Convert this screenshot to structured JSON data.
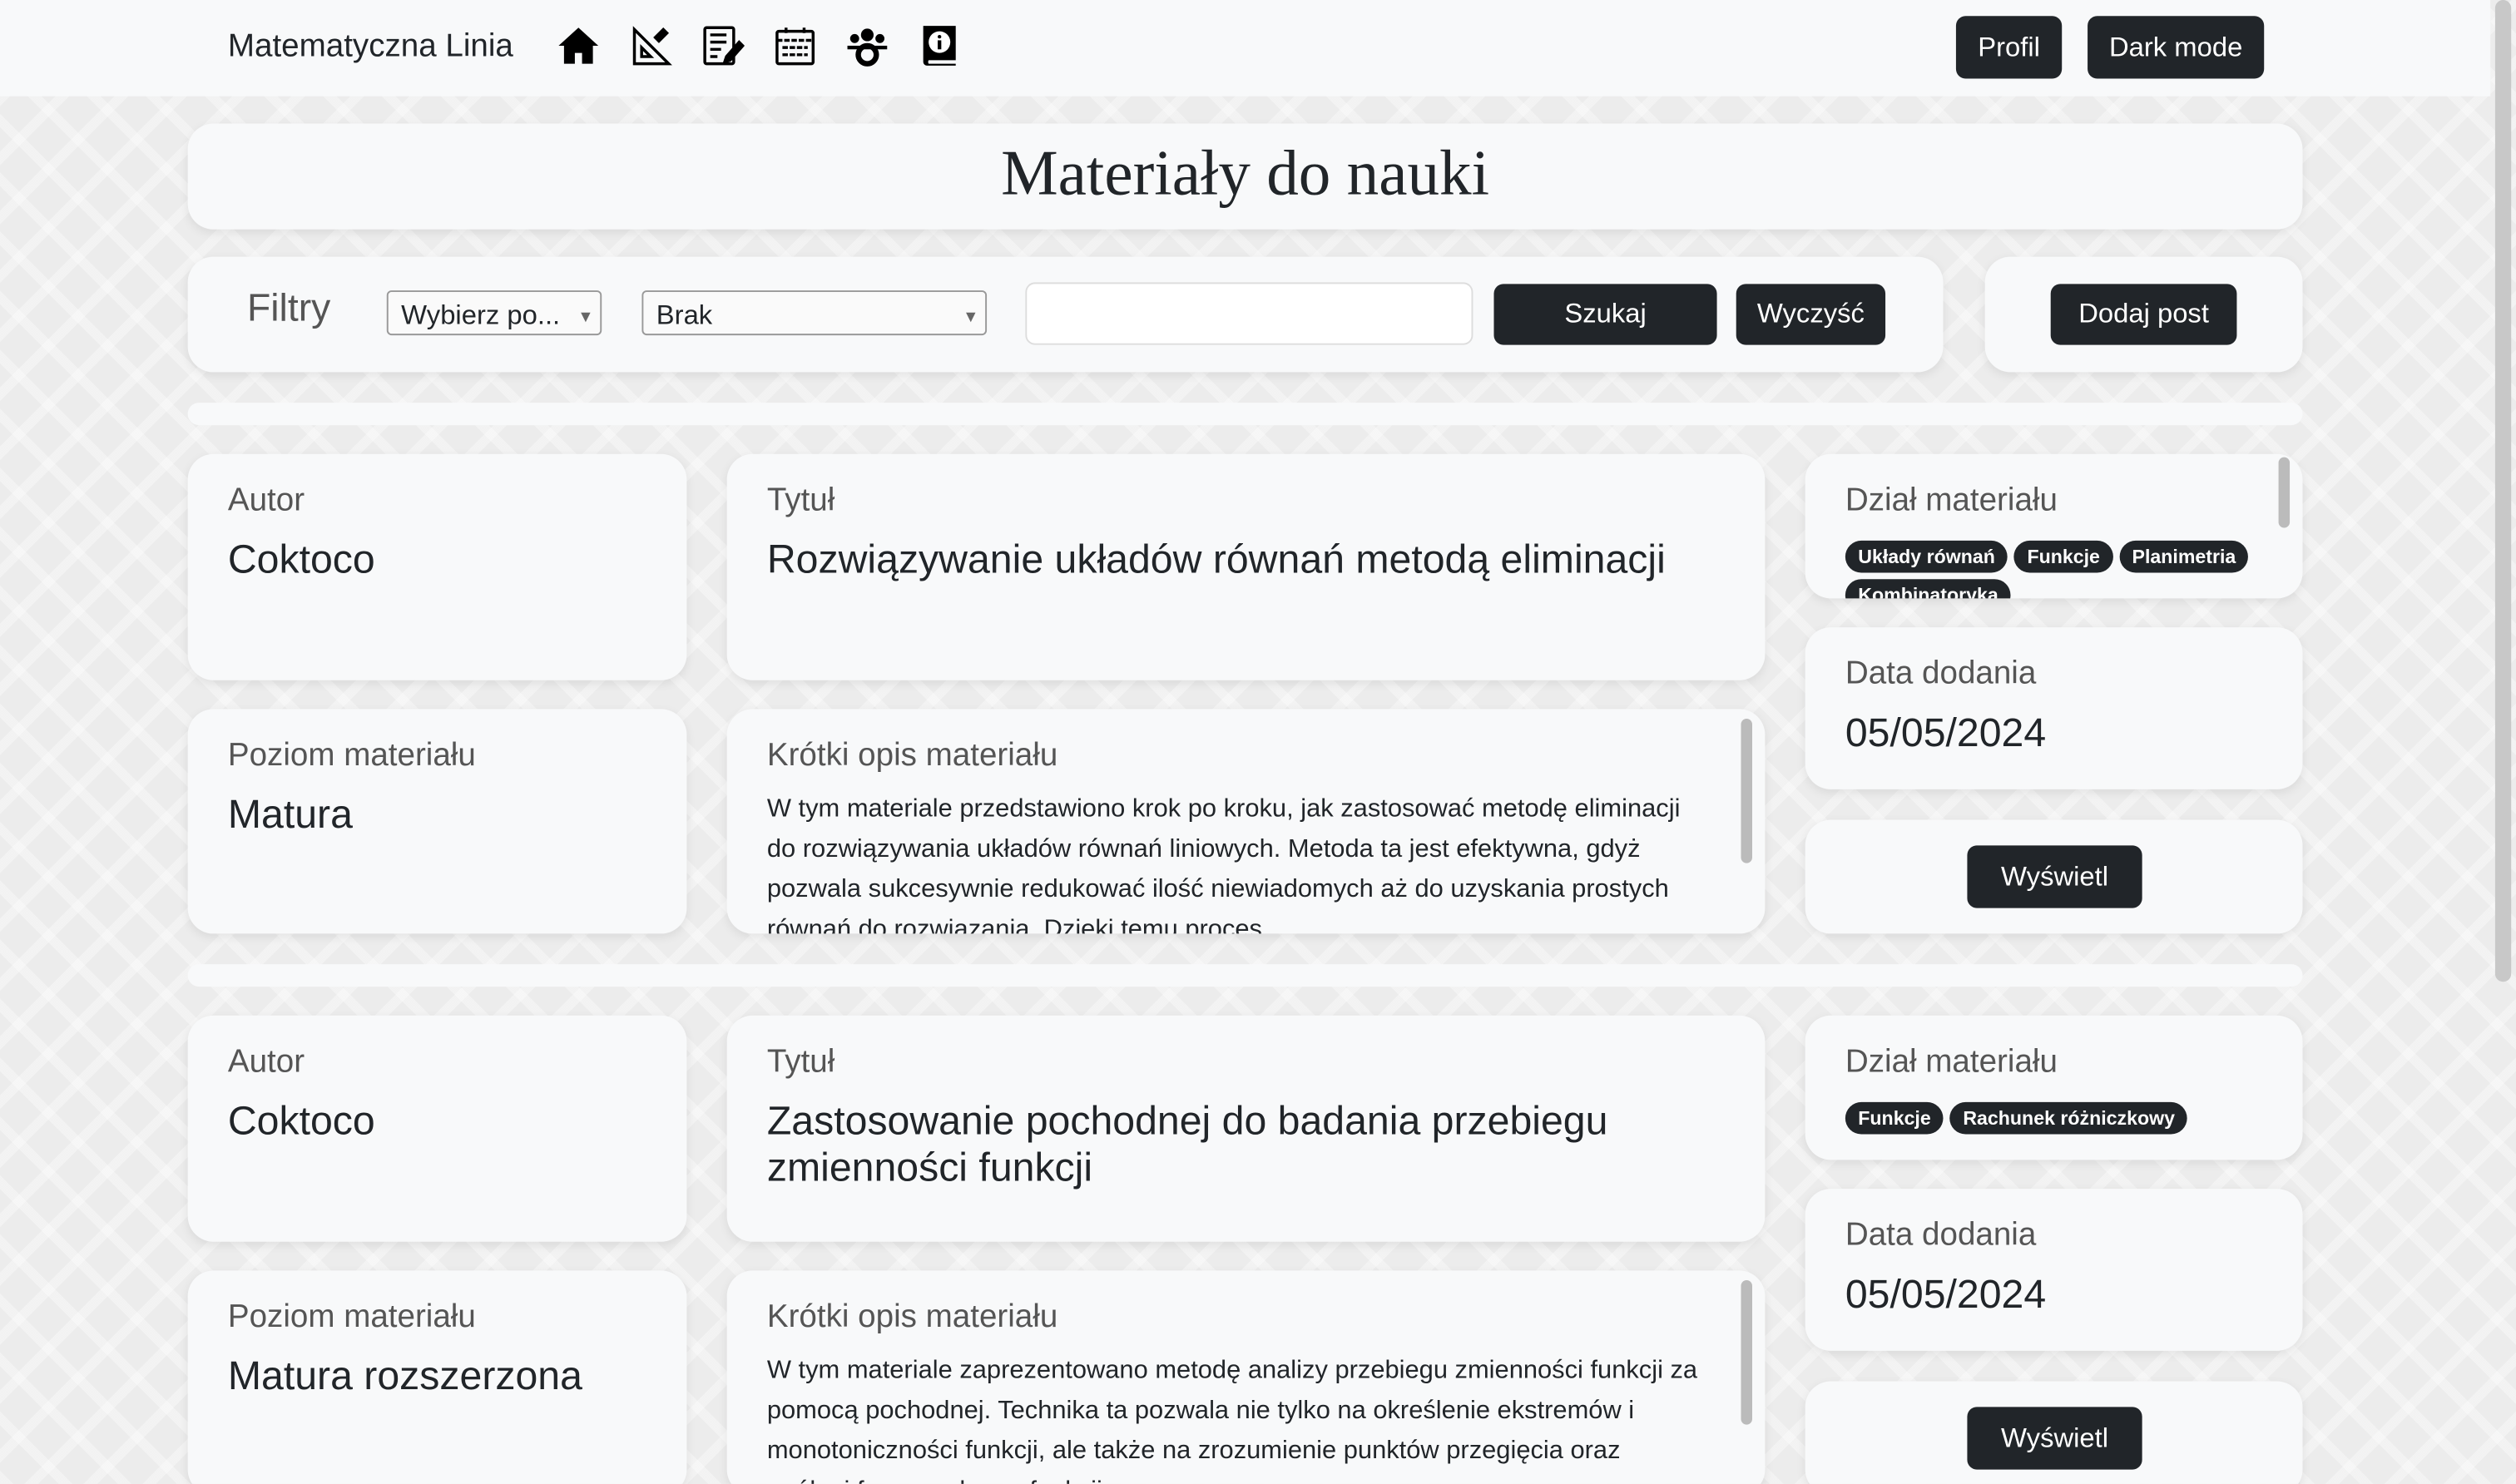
{
  "nav": {
    "brand": "Matematyczna Linia",
    "icons": [
      "home-icon",
      "ruler-triangle-icon",
      "note-edit-icon",
      "calendar-icon",
      "team-gear-icon",
      "info-book-icon"
    ],
    "profile": "Profil",
    "dark_mode": "Dark mode"
  },
  "header": {
    "title": "Materiały do nauki"
  },
  "filters": {
    "label": "Filtry",
    "select1": "Wybierz po...",
    "select2": "Brak",
    "search_value": "",
    "search": "Szukaj",
    "clear": "Wyczyść",
    "add_post": "Dodaj post"
  },
  "labels": {
    "author": "Autor",
    "title": "Tytuł",
    "section": "Dział materiału",
    "level": "Poziom materiału",
    "desc": "Krótki opis materiału",
    "date": "Data dodania",
    "view": "Wyświetl"
  },
  "posts": [
    {
      "author": "Coktoco",
      "title": "Rozwiązywanie układów równań metodą eliminacji",
      "tags": [
        "Układy równań",
        "Funkcje",
        "Planimetria",
        "Kombinatoryka"
      ],
      "level": "Matura",
      "date": "05/05/2024",
      "desc": "W tym materiale przedstawiono krok po kroku, jak zastosować metodę eliminacji do rozwiązywania układów równań liniowych. Metoda ta jest efektywna, gdyż pozwala sukcesywnie redukować ilość niewiadomych aż do uzyskania prostych równań do rozwiązania. Dzięki temu proces"
    },
    {
      "author": "Coktoco",
      "title": "Zastosowanie pochodnej do badania przebiegu zmienności funkcji",
      "tags": [
        "Funkcje",
        "Rachunek różniczkowy"
      ],
      "level": "Matura rozszerzona",
      "date": "05/05/2024",
      "desc": "W tym materiale zaprezentowano metodę analizy przebiegu zmienności funkcji za pomocą pochodnej. Technika ta pozwala nie tylko na określenie ekstremów i monotoniczności funkcji, ale także na zrozumienie punktów przegięcia oraz ogólnej formy wykresu funkcji."
    }
  ]
}
